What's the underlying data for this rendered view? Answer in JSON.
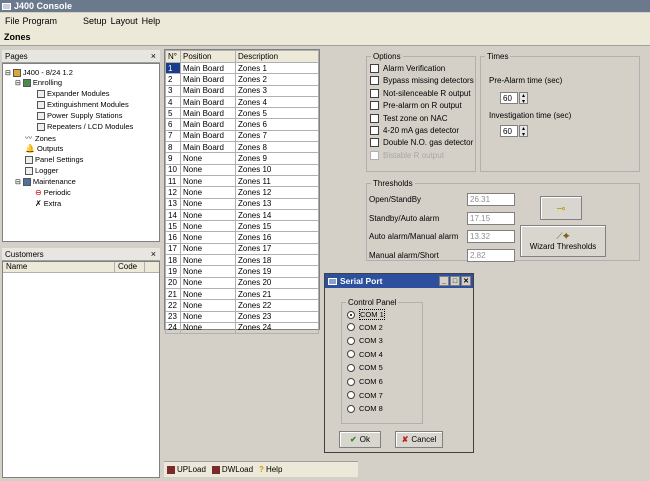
{
  "window": {
    "title": "J400 Console"
  },
  "menu": [
    "File",
    "Program",
    "Setup",
    "Layout",
    "Help"
  ],
  "section_title": "Zones",
  "pages_panel": {
    "title": "Pages",
    "close": "×",
    "tree": [
      "J400 - 8/24 1.2",
      "Enrolling",
      "Expander Modules",
      "Extinguishment Modules",
      "Power Supply Stations",
      "Repeaters / LCD Modules",
      "Zones",
      "Outputs",
      "Panel Settings",
      "Logger",
      "Maintenance",
      "Periodic",
      "Extra"
    ]
  },
  "customers_panel": {
    "title": "Customers",
    "close": "×",
    "columns": [
      "Name",
      "Code"
    ]
  },
  "zones_grid": {
    "columns": [
      "N°",
      "Position",
      "Description"
    ],
    "rows": [
      [
        "1",
        "Main Board",
        "Zones 1"
      ],
      [
        "2",
        "Main Board",
        "Zones 2"
      ],
      [
        "3",
        "Main Board",
        "Zones 3"
      ],
      [
        "4",
        "Main Board",
        "Zones 4"
      ],
      [
        "5",
        "Main Board",
        "Zones 5"
      ],
      [
        "6",
        "Main Board",
        "Zones 6"
      ],
      [
        "7",
        "Main Board",
        "Zones 7"
      ],
      [
        "8",
        "Main Board",
        "Zones 8"
      ],
      [
        "9",
        "None",
        "Zones 9"
      ],
      [
        "10",
        "None",
        "Zones 10"
      ],
      [
        "11",
        "None",
        "Zones 11"
      ],
      [
        "12",
        "None",
        "Zones 12"
      ],
      [
        "13",
        "None",
        "Zones 13"
      ],
      [
        "14",
        "None",
        "Zones 14"
      ],
      [
        "15",
        "None",
        "Zones 15"
      ],
      [
        "16",
        "None",
        "Zones 16"
      ],
      [
        "17",
        "None",
        "Zones 17"
      ],
      [
        "18",
        "None",
        "Zones 18"
      ],
      [
        "19",
        "None",
        "Zones 19"
      ],
      [
        "20",
        "None",
        "Zones 20"
      ],
      [
        "21",
        "None",
        "Zones 21"
      ],
      [
        "22",
        "None",
        "Zones 22"
      ],
      [
        "23",
        "None",
        "Zones 23"
      ],
      [
        "24",
        "None",
        "Zones 24"
      ]
    ]
  },
  "options": {
    "title": "Options",
    "items": [
      {
        "label": "Alarm Verification",
        "checked": false,
        "disabled": false
      },
      {
        "label": "Bypass missing detectors",
        "checked": false,
        "disabled": false
      },
      {
        "label": "Not-silenceable R output",
        "checked": false,
        "disabled": false
      },
      {
        "label": "Pre-alarm on R output",
        "checked": false,
        "disabled": false
      },
      {
        "label": "Test zone on NAC",
        "checked": false,
        "disabled": false
      },
      {
        "label": "4-20 mA gas detector",
        "checked": false,
        "disabled": false
      },
      {
        "label": "Double N.O. gas detector",
        "checked": false,
        "disabled": false
      },
      {
        "label": "Bistable R output",
        "checked": false,
        "disabled": true
      }
    ]
  },
  "times": {
    "title": "Times",
    "prealarm_label": "Pre-Alarm time (sec)",
    "prealarm_value": "60",
    "investigation_label": "Investigation time (sec)",
    "investigation_value": "60"
  },
  "thresholds": {
    "title": "Thresholds",
    "rows": [
      {
        "label": "Open/StandBy",
        "value": "26.31"
      },
      {
        "label": "Standby/Auto alarm",
        "value": "17.15"
      },
      {
        "label": "Auto alarm/Manual alarm",
        "value": "13.32"
      },
      {
        "label": "Manual alarm/Short",
        "value": "2.82"
      }
    ],
    "wizard_button": "Wizard Thresholds"
  },
  "serial_dialog": {
    "title": "Serial Port",
    "group": "Control Panel",
    "ports": [
      "COM 1",
      "COM 2",
      "COM 3",
      "COM 4",
      "COM 5",
      "COM 6",
      "COM 7",
      "COM 8"
    ],
    "selected": "COM 1",
    "ok": "Ok",
    "cancel": "Cancel"
  },
  "bottom_bar": {
    "upload": "UPLoad",
    "download": "DWLoad",
    "help": "Help"
  }
}
